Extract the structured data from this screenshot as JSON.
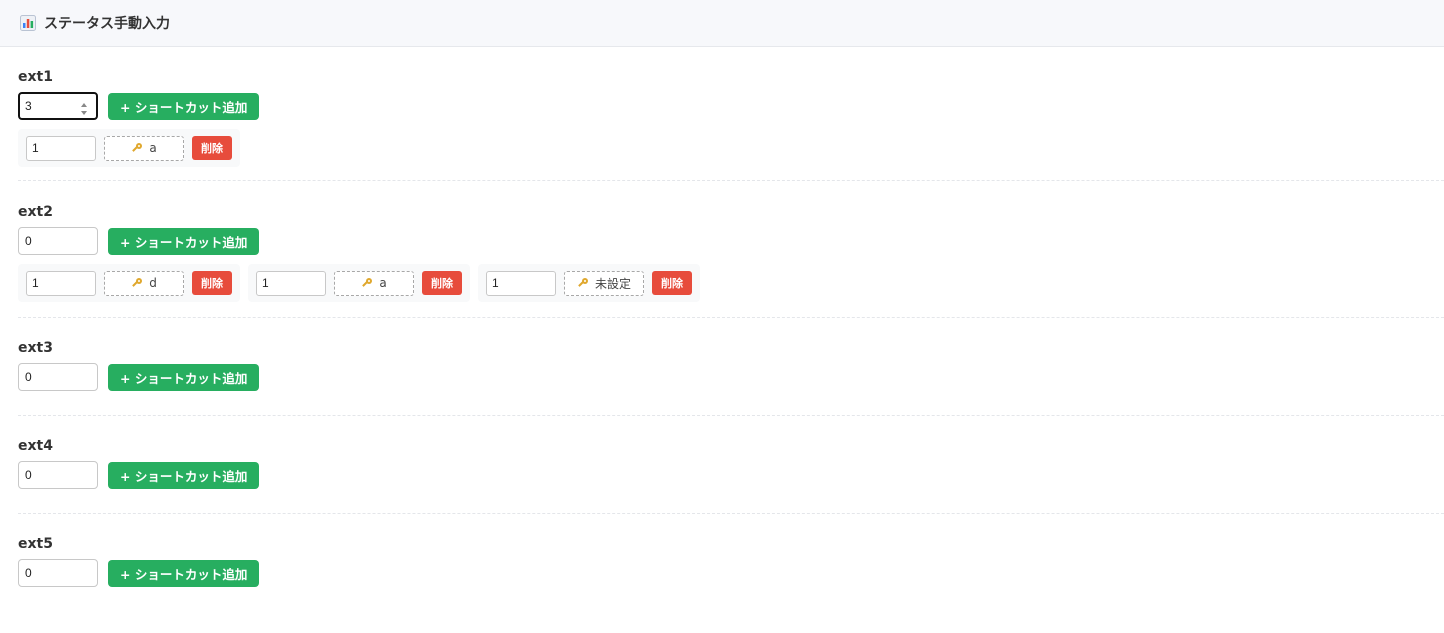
{
  "header": {
    "icon": "bar-chart-icon",
    "title": "ステータス手動入力"
  },
  "sections": [
    {
      "label": "ext1",
      "value": "3",
      "add_label": "+ ショートカット追加",
      "shortcuts": [
        {
          "amount": "1",
          "key": "a",
          "delete_label": "削除"
        }
      ]
    },
    {
      "label": "ext2",
      "value": "0",
      "add_label": "+ ショートカット追加",
      "shortcuts": [
        {
          "amount": "1",
          "key": "d",
          "delete_label": "削除"
        },
        {
          "amount": "1",
          "key": "a",
          "delete_label": "削除"
        },
        {
          "amount": "1",
          "key": "未設定",
          "delete_label": "削除"
        }
      ]
    },
    {
      "label": "ext3",
      "value": "0",
      "add_label": "+ ショートカット追加",
      "shortcuts": []
    },
    {
      "label": "ext4",
      "value": "0",
      "add_label": "+ ショートカット追加",
      "shortcuts": []
    },
    {
      "label": "ext5",
      "value": "0",
      "add_label": "+ ショートカット追加",
      "shortcuts": []
    }
  ],
  "colors": {
    "add_button": "#27ae60",
    "delete_button": "#e74c3c",
    "header_bg": "#f7f8fb"
  }
}
